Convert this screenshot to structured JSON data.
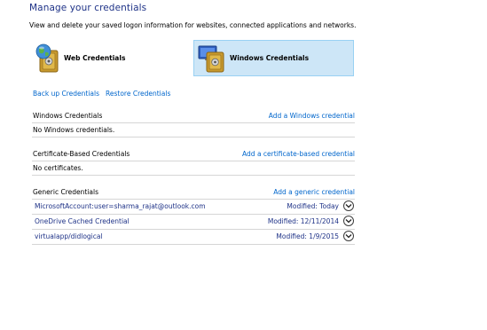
{
  "header": {
    "title": "Manage your credentials",
    "description": "View and delete your saved logon information for websites, connected applications and networks."
  },
  "tiles": {
    "web": {
      "label": "Web Credentials"
    },
    "windows": {
      "label": "Windows Credentials",
      "selected": true
    }
  },
  "backup": {
    "backup_label": "Back up Credentials",
    "restore_label": "Restore Credentials"
  },
  "sections": {
    "windows": {
      "title": "Windows Credentials",
      "action": "Add a Windows credential",
      "empty": "No Windows credentials."
    },
    "certificate": {
      "title": "Certificate-Based Credentials",
      "action": "Add a certificate-based credential",
      "empty": "No certificates."
    },
    "generic": {
      "title": "Generic Credentials",
      "action": "Add a generic credential",
      "items": [
        {
          "name": "MicrosoftAccount:user=sharma_rajat@outlook.com",
          "modified": "Modified:  Today"
        },
        {
          "name": "OneDrive Cached Credential",
          "modified": "Modified:  12/11/2014"
        },
        {
          "name": "virtualapp/didlogical",
          "modified": "Modified:  1/9/2015"
        }
      ]
    }
  },
  "colors": {
    "title": "#1e3287",
    "link": "#0066cc",
    "selected_tile_bg": "#cde6f7",
    "selected_tile_border": "#99d1f3",
    "divider": "#d6d6d6"
  },
  "icons": {
    "web": "globe-safe-icon",
    "windows": "windows-safe-icon",
    "expand": "chevron-down-icon"
  }
}
